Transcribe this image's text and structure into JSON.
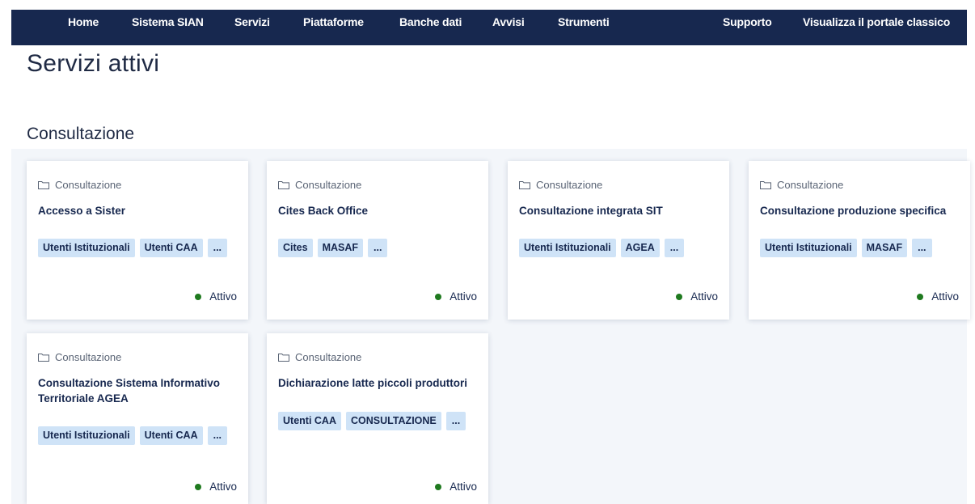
{
  "nav": {
    "home": "Home",
    "sistema": "Sistema SIAN",
    "servizi": "Servizi",
    "piattaforme": "Piattaforme",
    "banche": "Banche dati",
    "avvisi": "Avvisi",
    "strumenti": "Strumenti",
    "supporto": "Supporto",
    "classico": "Visualizza il portale classico"
  },
  "page_title": "Servizi attivi",
  "section_title": "Consultazione",
  "cards": [
    {
      "category": "Consultazione",
      "title": "Accesso a Sister",
      "tags": [
        "Utenti Istituzionali",
        "Utenti CAA",
        "..."
      ],
      "status": "Attivo"
    },
    {
      "category": "Consultazione",
      "title": "Cites Back Office",
      "tags": [
        "Cites",
        "MASAF",
        "..."
      ],
      "status": "Attivo"
    },
    {
      "category": "Consultazione",
      "title": "Consultazione integrata SIT",
      "tags": [
        "Utenti Istituzionali",
        "AGEA",
        "..."
      ],
      "status": "Attivo"
    },
    {
      "category": "Consultazione",
      "title": "Consultazione produzione specifica",
      "tags": [
        "Utenti Istituzionali",
        "MASAF",
        "..."
      ],
      "status": "Attivo"
    },
    {
      "category": "Consultazione",
      "title": "Consultazione Sistema Informativo Territoriale AGEA",
      "tags": [
        "Utenti Istituzionali",
        "Utenti CAA",
        "..."
      ],
      "status": "Attivo"
    },
    {
      "category": "Consultazione",
      "title": "Dichiarazione latte piccoli produttori",
      "tags": [
        "Utenti CAA",
        "CONSULTAZIONE",
        "..."
      ],
      "status": "Attivo"
    }
  ],
  "colors": {
    "nav_bg": "#17284f",
    "tag_bg": "#cfe3f7",
    "status_dot": "#1f7a1f"
  }
}
